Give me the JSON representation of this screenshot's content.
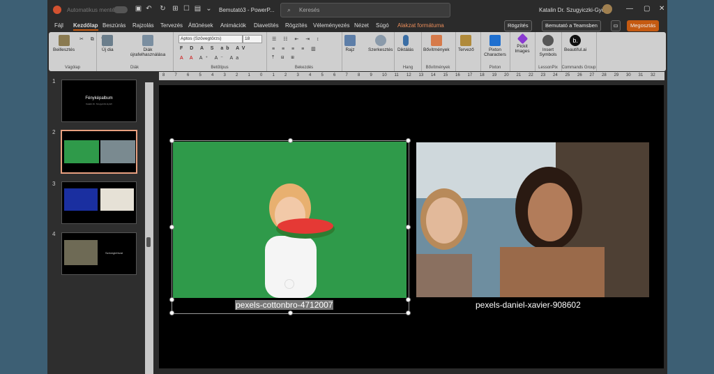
{
  "titlebar": {
    "autosave": "Automatikus mentés",
    "doc_title": "Bemutató3 - PowerP...",
    "search_placeholder": "Keresés",
    "user": "Katalin Dr. Szugyiczki-Györfi"
  },
  "tabs": [
    "Fájl",
    "Kezdőlap",
    "Beszúrás",
    "Rajzolás",
    "Tervezés",
    "Áttűnések",
    "Animációk",
    "Diavetítés",
    "Rögzítés",
    "Véleményezés",
    "Nézet",
    "Súgó",
    "Alakzat formátuma"
  ],
  "active_tab": "Kezdőlap",
  "title_buttons": {
    "record": "Rögzítés",
    "teams": "Bemutató a Teamsben",
    "share": "Megosztás"
  },
  "ribbon": {
    "groups": [
      "Vágólap",
      "Diák",
      "Betűtípus",
      "Bekezdés",
      "Hang",
      "Bővítmények",
      "Pixton",
      "LessonPix",
      "Commands Group"
    ],
    "buttons": {
      "paste": "Beillesztés",
      "new_slide": "Új dia",
      "reuse": "Diák újrafelhasználása",
      "draw": "Rajz",
      "editing": "Szerkesztés",
      "dictate": "Diktálás",
      "addins": "Bővítmények",
      "designer": "Tervező",
      "pixton": "Pixton Characters",
      "pickit": "Pickit Images",
      "insert_symbols": "Insert Symbols",
      "beautiful": "Beautiful.ai"
    },
    "font_name": "Aptos (Szövegtörzs)",
    "font_size": "18",
    "format_row": "F D A S ab AV"
  },
  "slides": [
    {
      "num": "1",
      "title": "Fényképalbum",
      "subtitle": "Katalin Dr. Szugyiczki-Györfi"
    },
    {
      "num": "2"
    },
    {
      "num": "3"
    },
    {
      "num": "4",
      "title": "Szöveglehivat"
    }
  ],
  "selected_slide": "2",
  "ruler": [
    "8",
    "7",
    "6",
    "5",
    "4",
    "3",
    "2",
    "1",
    "0",
    "1",
    "2",
    "3",
    "4",
    "5",
    "6",
    "7",
    "8",
    "9",
    "10",
    "11",
    "12",
    "13",
    "14",
    "15",
    "16",
    "17",
    "18",
    "19",
    "20",
    "21",
    "22",
    "23",
    "24",
    "25",
    "26",
    "27",
    "28",
    "29",
    "30",
    "31",
    "32"
  ],
  "canvas": {
    "caption1": "pexels-cottonbro-4712007",
    "caption2": "pexels-daniel-xavier-908602"
  },
  "colors": {
    "accent": "#c55a11",
    "slide_bg": "#000000",
    "ribbon_bg": "#cfcfcf",
    "photo1_bg": "#2f9a4a"
  }
}
